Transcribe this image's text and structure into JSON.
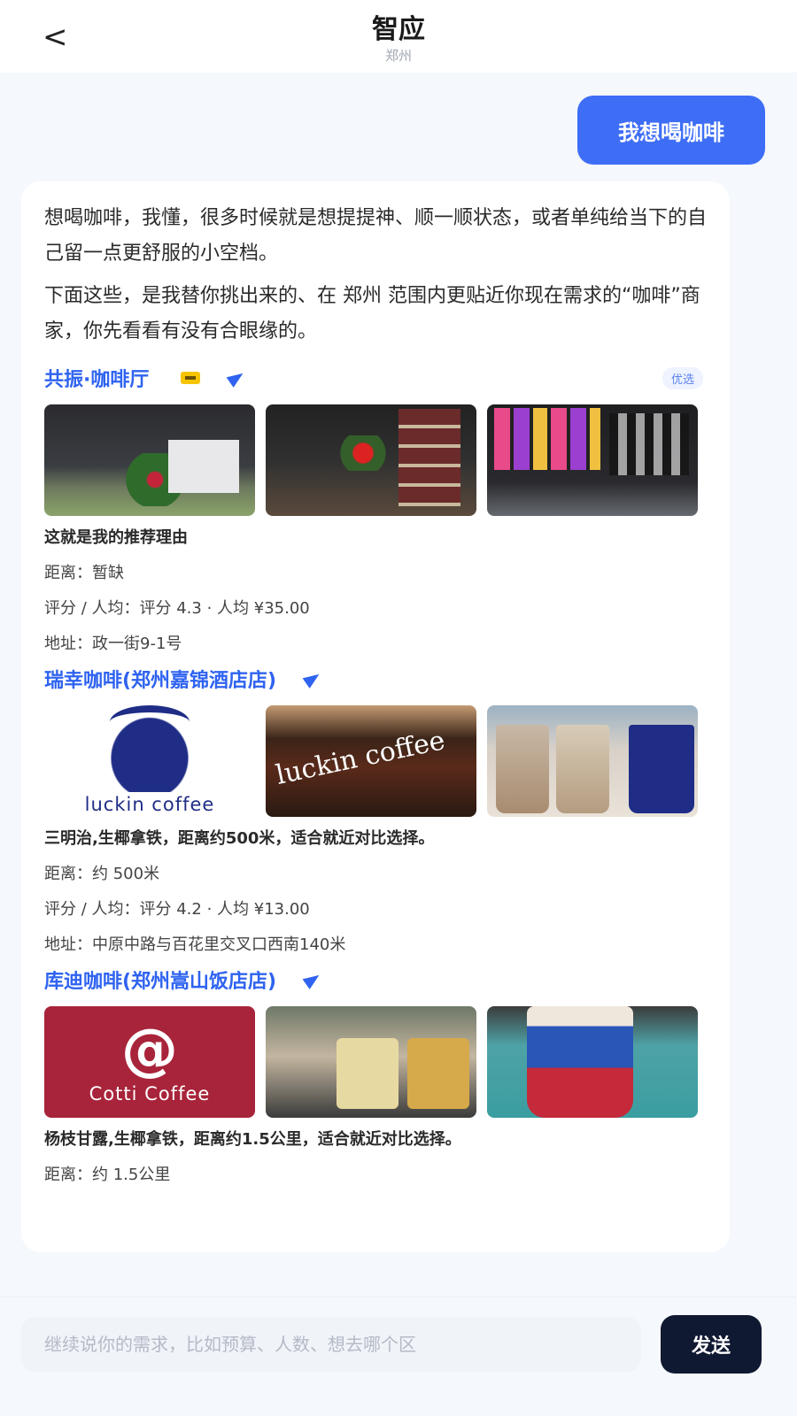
{
  "header": {
    "back_glyph": "<",
    "title": "智应",
    "subtitle": "郑州"
  },
  "user_message": "我想喝咖啡",
  "assistant": {
    "intro_1": "想喝咖啡，我懂，很多时候就是想提提神、顺一顺状态，或者单纯给当下的自己留一点更舒服的小空档。",
    "intro_2": "下面这些，是我替你挑出来的、在 郑州 范围内更贴近你现在需求的“咖啡”商家，你先看看有没有合眼缘的。",
    "merchants": [
      {
        "name": "共振·咖啡厅",
        "tag": "优选",
        "reason": "这就是我的推荐理由",
        "distance": "距离：暂缺",
        "rating": "评分 / 人均：评分 4.3 · 人均 ¥35.00",
        "address": "地址：政一街9-1号"
      },
      {
        "name": "瑞幸咖啡(郑州嘉锦酒店店)",
        "logo_text": "luckin coffee",
        "sign_text": "luckin coffee",
        "reason": "三明治,生椰拿铁，距离约500米，适合就近对比选择。",
        "distance": "距离：约 500米",
        "rating": "评分 / 人均：评分 4.2 · 人均 ¥13.00",
        "address": "地址：中原中路与百花里交叉口西南140米"
      },
      {
        "name": "库迪咖啡(郑州嵩山饭店店)",
        "logo_symbol": "@",
        "logo_text": "Cotti Coffee",
        "reason": "杨枝甘露,生椰拿铁，距离约1.5公里，适合就近对比选择。",
        "distance": "距离：约 1.5公里"
      }
    ]
  },
  "composer": {
    "placeholder": "继续说你的需求，比如预算、人数、想去哪个区",
    "send_label": "发送"
  },
  "colors": {
    "accent": "#3e6ef6",
    "merchant_name": "#2f63f0",
    "send_button": "#101932"
  }
}
